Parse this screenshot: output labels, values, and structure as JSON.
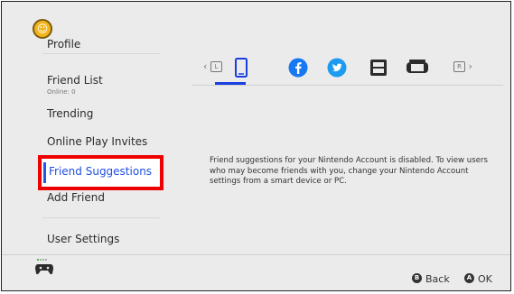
{
  "sidebar": {
    "items": [
      {
        "label": "Profile"
      },
      {
        "label": "Friend List",
        "sub": "Online: 0"
      },
      {
        "label": "Trending"
      },
      {
        "label": "Online Play Invites"
      },
      {
        "label": "Friend Suggestions"
      },
      {
        "label": "Add Friend"
      },
      {
        "label": "User Settings"
      }
    ]
  },
  "tabs": {
    "left_hint": "L",
    "right_hint": "R",
    "items": [
      {
        "icon": "smartphone-icon",
        "selected": true
      },
      {
        "icon": "facebook-icon"
      },
      {
        "icon": "twitter-icon"
      },
      {
        "icon": "nintendo-3ds-icon"
      },
      {
        "icon": "wii-u-icon"
      }
    ]
  },
  "main": {
    "message": "Friend suggestions for your Nintendo Account is disabled. To view users who may become friends with you, change your Nintendo Account settings from a smart device or PC."
  },
  "footer": {
    "back_button_glyph": "B",
    "back_label": "Back",
    "ok_button_glyph": "A",
    "ok_label": "OK"
  },
  "colors": {
    "accent": "#1a3fe0",
    "selection_outline": "#ee0000",
    "facebook": "#1877f2",
    "twitter": "#1d9bf0"
  }
}
